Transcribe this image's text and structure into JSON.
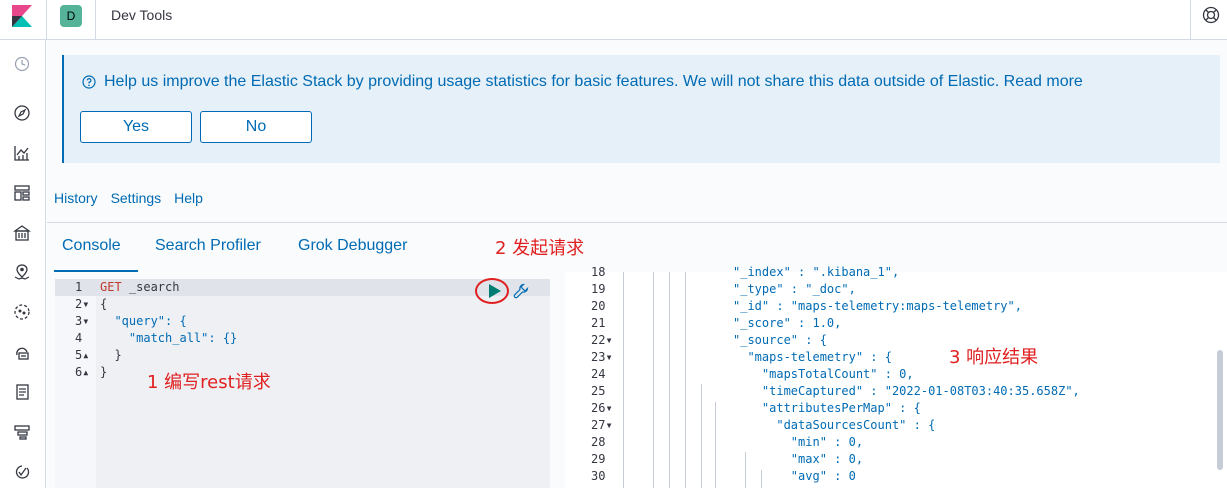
{
  "header": {
    "space_initial": "D",
    "app_title": "Dev Tools",
    "colors": {
      "space_avatar": "#54b399",
      "accent": "#006bb4"
    }
  },
  "sidenav": {
    "icons": [
      "clock-icon",
      "compass-icon",
      "visualize-icon",
      "dashboard-icon",
      "canvas-icon",
      "maps-icon",
      "ml-icon",
      "infrastructure-icon",
      "logs-icon",
      "apm-icon",
      "uptime-icon"
    ]
  },
  "callout": {
    "text": "Help us improve the Elastic Stack by providing usage statistics for basic features. We will not share this data outside of Elastic. Read more",
    "yes_label": "Yes",
    "no_label": "No"
  },
  "topnav": {
    "history": "History",
    "settings": "Settings",
    "help": "Help"
  },
  "tabs": {
    "console": "Console",
    "search_profiler": "Search Profiler",
    "grok_debugger": "Grok Debugger"
  },
  "annotations": {
    "send_request": "2 发起请求",
    "write_request": "1 编写rest请求",
    "response_result": "3 响应结果",
    "color": "#e02020"
  },
  "request": {
    "lines": [
      {
        "n": "1",
        "fold": "",
        "method": "GET",
        "text": " _search"
      },
      {
        "n": "2",
        "fold": "▾",
        "text": "{"
      },
      {
        "n": "3",
        "fold": "▾",
        "text": "  \"query\": {"
      },
      {
        "n": "4",
        "fold": "",
        "text": "    \"match_all\": {}"
      },
      {
        "n": "5",
        "fold": "▴",
        "text": "  }"
      },
      {
        "n": "6",
        "fold": "▴",
        "text": "}"
      }
    ]
  },
  "response": {
    "lines": [
      {
        "n": "18",
        "fold": "",
        "text": "\"_index\" : \".kibana_1\","
      },
      {
        "n": "19",
        "fold": "",
        "text": "\"_type\" : \"_doc\","
      },
      {
        "n": "20",
        "fold": "",
        "text": "\"_id\" : \"maps-telemetry:maps-telemetry\","
      },
      {
        "n": "21",
        "fold": "",
        "text": "\"_score\" : 1.0,"
      },
      {
        "n": "22",
        "fold": "▾",
        "text": "\"_source\" : {"
      },
      {
        "n": "23",
        "fold": "▾",
        "text": "  \"maps-telemetry\" : {"
      },
      {
        "n": "24",
        "fold": "",
        "text": "    \"mapsTotalCount\" : 0,"
      },
      {
        "n": "25",
        "fold": "",
        "text": "    \"timeCaptured\" : \"2022-01-08T03:40:35.658Z\","
      },
      {
        "n": "26",
        "fold": "▾",
        "text": "    \"attributesPerMap\" : {"
      },
      {
        "n": "27",
        "fold": "▾",
        "text": "      \"dataSourcesCount\" : {"
      },
      {
        "n": "28",
        "fold": "",
        "text": "        \"min\" : 0,"
      },
      {
        "n": "29",
        "fold": "",
        "text": "        \"max\" : 0,"
      },
      {
        "n": "30",
        "fold": "",
        "text": "        \"avg\" : 0"
      }
    ]
  }
}
